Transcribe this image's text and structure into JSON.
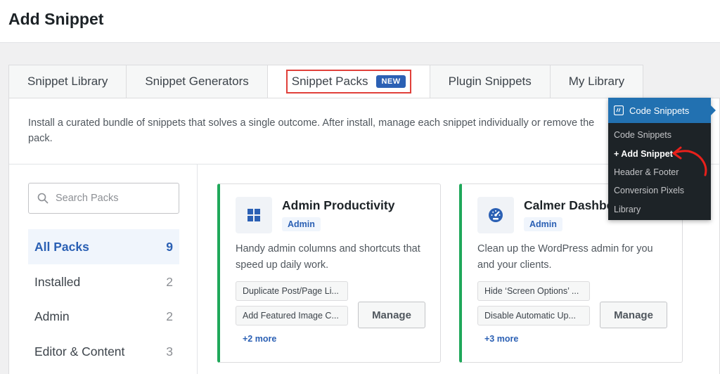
{
  "header": {
    "title": "Add Snippet"
  },
  "tabs": [
    {
      "label": "Snippet Library"
    },
    {
      "label": "Snippet Generators"
    },
    {
      "label": "Snippet Packs",
      "badge": "NEW"
    },
    {
      "label": "Plugin Snippets"
    },
    {
      "label": "My Library"
    }
  ],
  "description": "Install a curated bundle of snippets that solves a single outcome. After install, manage each snippet individually or remove the pack.",
  "search": {
    "placeholder": "Search Packs"
  },
  "categories": [
    {
      "label": "All Packs",
      "count": "9"
    },
    {
      "label": "Installed",
      "count": "2"
    },
    {
      "label": "Admin",
      "count": "2"
    },
    {
      "label": "Editor & Content",
      "count": "3"
    }
  ],
  "cards": [
    {
      "title": "Admin Productivity",
      "tag": "Admin",
      "description": "Handy admin columns and shortcuts that speed up daily work.",
      "snippets": [
        "Duplicate Post/Page Li...",
        "Add Featured Image C..."
      ],
      "more": "+2 more",
      "button": "Manage",
      "icon": "grid-icon"
    },
    {
      "title": "Calmer Dashboard",
      "tag": "Admin",
      "description": "Clean up the WordPress admin for you and your clients.",
      "snippets": [
        "Hide ‘Screen Options’ ...",
        "Disable Automatic Up..."
      ],
      "more": "+3 more",
      "button": "Manage",
      "icon": "dashboard-gauge-icon"
    }
  ],
  "admin_menu": {
    "header": "Code Snippets",
    "items": [
      "Code Snippets",
      "+ Add Snippet",
      "Header & Footer",
      "Conversion Pixels",
      "Library"
    ]
  },
  "colors": {
    "accent": "#2b60b4",
    "green": "#1fa85a",
    "highlight": "#e0403a",
    "menu_bg": "#1d2327"
  }
}
